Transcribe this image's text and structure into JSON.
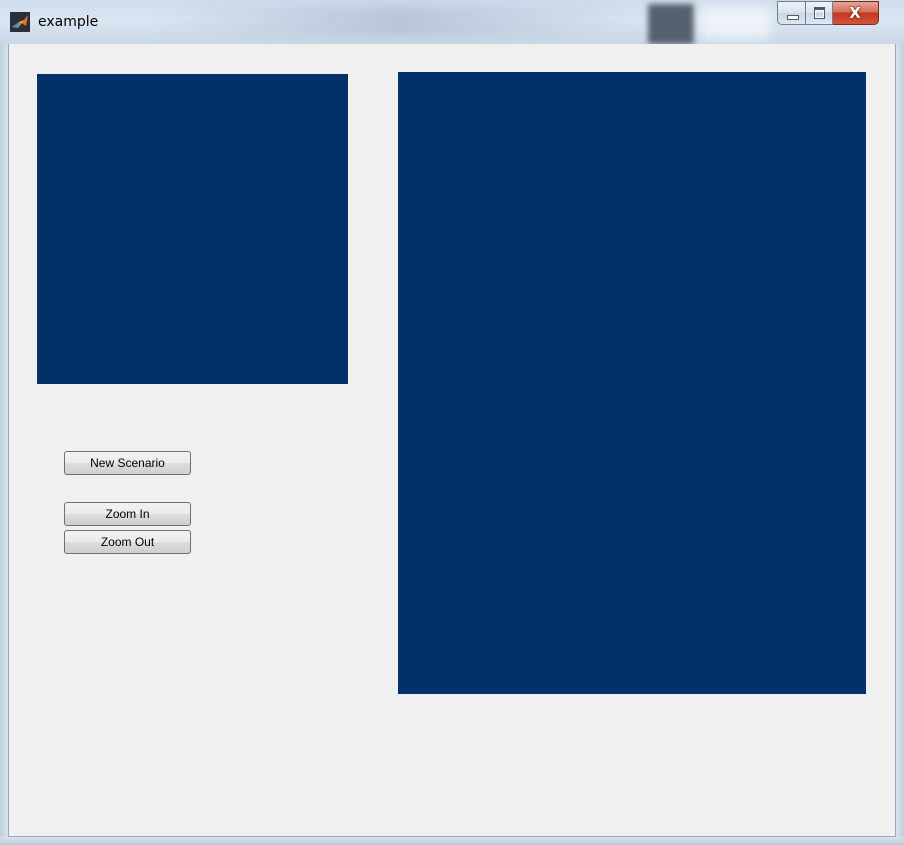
{
  "window": {
    "title": "example",
    "controls": {
      "minimize_icon": "minimize-icon",
      "maximize_icon": "maximize-icon",
      "close_icon": "close-icon",
      "close_glyph": "X"
    }
  },
  "panels": {
    "color": "#003269"
  },
  "buttons": {
    "new_scenario": "New Scenario",
    "zoom_in": "Zoom In",
    "zoom_out": "Zoom Out"
  }
}
